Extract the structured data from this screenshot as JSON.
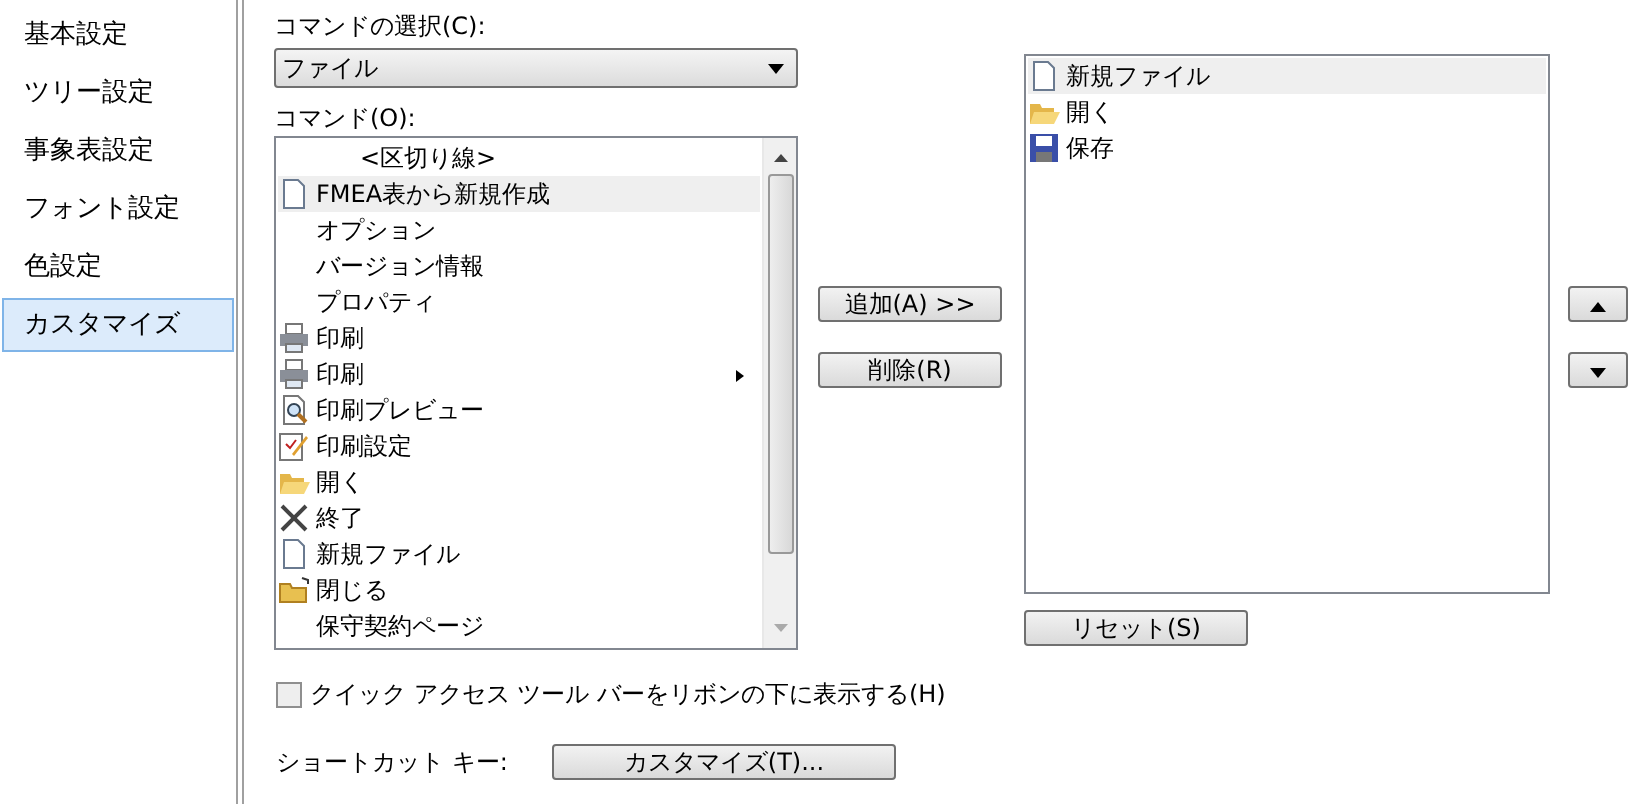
{
  "sidebar": {
    "items": [
      {
        "label": "基本設定",
        "selected": false
      },
      {
        "label": "ツリー設定",
        "selected": false
      },
      {
        "label": "事象表設定",
        "selected": false
      },
      {
        "label": "フォント設定",
        "selected": false
      },
      {
        "label": "色設定",
        "selected": false
      },
      {
        "label": "カスタマイズ",
        "selected": true
      }
    ]
  },
  "command_select": {
    "label": "コマンドの選択(C):",
    "value": "ファイル"
  },
  "commands": {
    "label": "コマンド(O):",
    "items": [
      {
        "label": "<区切り線>",
        "kind": "separator",
        "selected": false,
        "submenu": false
      },
      {
        "label": "FMEA表から新規作成",
        "kind": "document",
        "selected": true,
        "submenu": false
      },
      {
        "label": "オプション",
        "kind": "plain",
        "selected": false,
        "submenu": false
      },
      {
        "label": "バージョン情報",
        "kind": "plain",
        "selected": false,
        "submenu": false
      },
      {
        "label": "プロパティ",
        "kind": "plain",
        "selected": false,
        "submenu": false
      },
      {
        "label": "印刷",
        "kind": "printer",
        "selected": false,
        "submenu": false
      },
      {
        "label": "印刷",
        "kind": "printer",
        "selected": false,
        "submenu": true
      },
      {
        "label": "印刷プレビュー",
        "kind": "preview",
        "selected": false,
        "submenu": false
      },
      {
        "label": "印刷設定",
        "kind": "settings",
        "selected": false,
        "submenu": false
      },
      {
        "label": "開く",
        "kind": "open",
        "selected": false,
        "submenu": false
      },
      {
        "label": "終了",
        "kind": "exit",
        "selected": false,
        "submenu": false
      },
      {
        "label": "新規ファイル",
        "kind": "document",
        "selected": false,
        "submenu": false
      },
      {
        "label": "閉じる",
        "kind": "folder",
        "selected": false,
        "submenu": false
      },
      {
        "label": "保守契約ページ",
        "kind": "plain",
        "selected": false,
        "submenu": false
      }
    ]
  },
  "add_button": "追加(A) >>",
  "remove_button": "削除(R)",
  "toolbar_items": [
    {
      "label": "新規ファイル",
      "kind": "document",
      "selected": true
    },
    {
      "label": "開く",
      "kind": "open",
      "selected": false
    },
    {
      "label": "保存",
      "kind": "save",
      "selected": false
    }
  ],
  "reset_button": "リセット(S)",
  "below_ribbon": {
    "label": "クイック アクセス ツール バーをリボンの下に表示する(H)",
    "checked": false
  },
  "shortcut": {
    "label": "ショートカット キー:",
    "button": "カスタマイズ(T)..."
  }
}
